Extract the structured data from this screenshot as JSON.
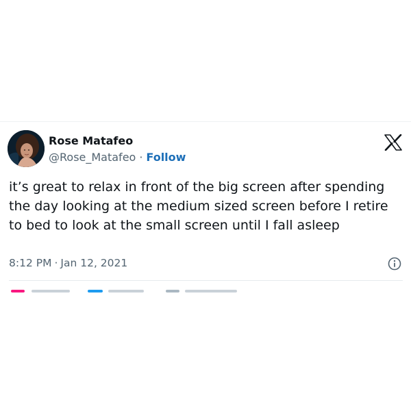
{
  "tweet": {
    "author": {
      "display_name": "Rose Matafeo",
      "handle": "@Rose_Matafeo",
      "separator": "·",
      "follow_label": "Follow"
    },
    "text": "it’s great to relax in front of the big screen after spending the day looking at the medium sized screen before I retire to bed to look at the small screen until I fall asleep",
    "time": "8:12 PM",
    "time_separator": "·",
    "date": "Jan 12, 2021"
  },
  "icons": {
    "brand": "x-logo-icon",
    "info": "info-icon",
    "avatar": "avatar"
  },
  "colors": {
    "name": "#0f1419",
    "secondary": "#536471",
    "follow": "#1d6fb8",
    "like": "#f91880",
    "reply": "#1d9bf0"
  }
}
